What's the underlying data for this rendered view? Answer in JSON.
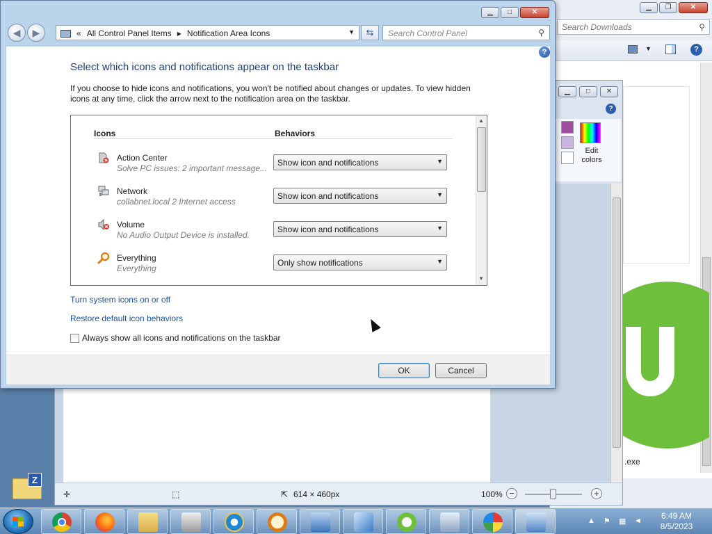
{
  "background": {
    "explorer": {
      "search_placeholder": "Search Downloads",
      "file_label": ".exe"
    },
    "paint": {
      "edit_colors_label": "Edit colors",
      "status": {
        "dimensions": "614 × 460px",
        "zoom": "100%"
      },
      "colors": {
        "purple": "#a14ca3",
        "lavender": "#c8b6e0"
      }
    },
    "utorrent_color": "#6dbf3c"
  },
  "dialog": {
    "address": {
      "separator": "«",
      "crumb_1": "All Control Panel Items",
      "arrow": "▶",
      "crumb_2": "Notification Area Icons"
    },
    "search_placeholder": "Search Control Panel",
    "heading": "Select which icons and notifications appear on the taskbar",
    "description": "If you choose to hide icons and notifications, you won't be notified about changes or updates. To view hidden icons at any time, click the arrow next to the notification area on the taskbar.",
    "columns": {
      "icons": "Icons",
      "behaviors": "Behaviors"
    },
    "rows": [
      {
        "name": "Action Center",
        "sub": "Solve PC issues: 2 important message...",
        "behavior": "Show icon and notifications",
        "icon": "action-center-icon"
      },
      {
        "name": "Network",
        "sub": "collabnet.local  2 Internet access",
        "behavior": "Show icon and notifications",
        "icon": "network-icon"
      },
      {
        "name": "Volume",
        "sub": "No Audio Output Device is installed.",
        "behavior": "Show icon and notifications",
        "icon": "volume-icon"
      },
      {
        "name": "Everything",
        "sub": "Everything",
        "behavior": "Only show notifications",
        "icon": "everything-search-icon"
      }
    ],
    "links": {
      "system_icons": "Turn system icons on or off",
      "restore": "Restore default icon behaviors"
    },
    "checkbox_label": "Always show all icons and notifications on the taskbar",
    "buttons": {
      "ok": "OK",
      "cancel": "Cancel"
    }
  },
  "taskbar": {
    "clock_time": "6:49 AM",
    "clock_date": "8/5/2023",
    "apps": [
      "chrome-icon",
      "firefox-icon",
      "file-explorer-icon",
      "fax-scanner-icon",
      "internet-explorer-icon",
      "everything-search-icon",
      "network-share-icon",
      "mail-icon",
      "utorrent-icon",
      "calculator-icon",
      "paint-icon",
      "control-panel-icon"
    ]
  }
}
